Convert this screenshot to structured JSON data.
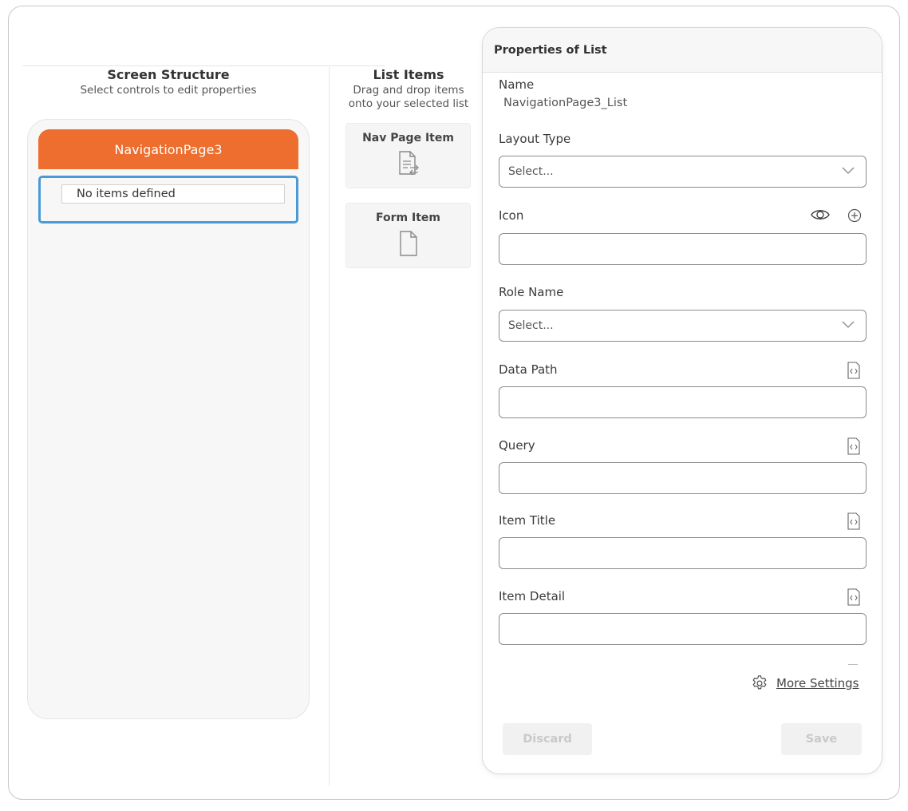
{
  "screen_structure": {
    "title": "Screen Structure",
    "subtitle": "Select controls to edit properties",
    "nav_page_name": "NavigationPage3",
    "empty_list_text": "No items defined"
  },
  "list_items": {
    "title": "List Items",
    "subtitle_line1": "Drag and drop items",
    "subtitle_line2": "onto your selected list",
    "items": [
      {
        "label": "Nav Page Item",
        "icon": "nav-page-document-icon"
      },
      {
        "label": "Form Item",
        "icon": "form-document-icon"
      }
    ]
  },
  "properties": {
    "header": "Properties of List",
    "name_label": "Name",
    "name_value": "NavigationPage3_List",
    "layout_type_label": "Layout Type",
    "layout_type_value": "Select...",
    "icon_label": "Icon",
    "icon_value": "",
    "role_name_label": "Role Name",
    "role_name_value": "Select...",
    "data_path_label": "Data Path",
    "data_path_value": "",
    "query_label": "Query",
    "query_value": "",
    "item_title_label": "Item Title",
    "item_title_value": "",
    "item_detail_label": "Item Detail",
    "item_detail_value": "",
    "more_settings": "More Settings",
    "discard_label": "Discard",
    "save_label": "Save"
  },
  "colors": {
    "nav_header": "#ed6e2f",
    "selected_border": "#4a9ad6"
  }
}
